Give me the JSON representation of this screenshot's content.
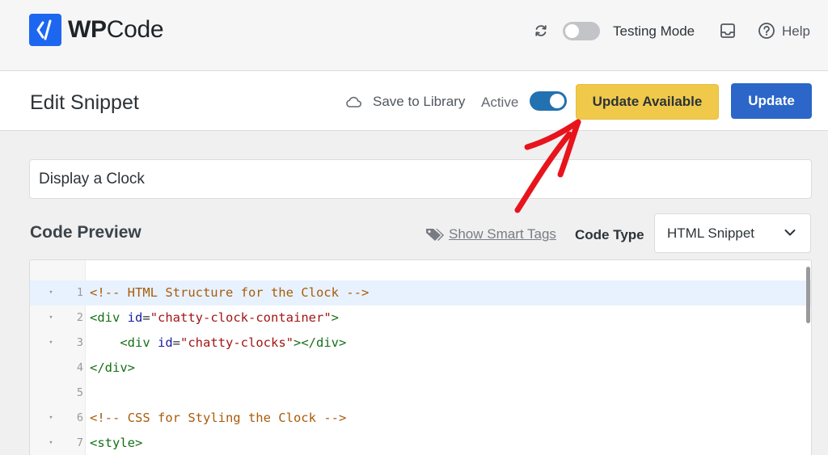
{
  "header": {
    "logo_bold": "WP",
    "logo_light": "Code",
    "testing_mode_label": "Testing Mode",
    "help_label": "Help"
  },
  "editbar": {
    "title": "Edit Snippet",
    "save_to_library": "Save to Library",
    "active_label": "Active",
    "update_available_label": "Update Available",
    "update_label": "Update"
  },
  "snippet": {
    "title_value": "Display a Clock"
  },
  "code_preview": {
    "label": "Code Preview",
    "smart_tags_link": "Show Smart Tags",
    "code_type_label": "Code Type",
    "code_type_value": "HTML Snippet"
  },
  "editor": {
    "lines": [
      {
        "num": "1",
        "fold": "▾"
      },
      {
        "num": "2",
        "fold": "▾"
      },
      {
        "num": "3",
        "fold": "▾"
      },
      {
        "num": "4",
        "fold": ""
      },
      {
        "num": "5",
        "fold": ""
      },
      {
        "num": "6",
        "fold": "▾"
      },
      {
        "num": "7",
        "fold": "▾"
      }
    ],
    "code": {
      "l1_comment": "<!-- HTML Structure for the Clock -->",
      "l2_open": "<div ",
      "l2_attr": "id",
      "l2_eq": "=",
      "l2_val": "\"chatty-clock-container\"",
      "l2_close": ">",
      "l3_indent": "    ",
      "l3_open": "<div ",
      "l3_attr": "id",
      "l3_eq": "=",
      "l3_val": "\"chatty-clocks\"",
      "l3_close": "></div>",
      "l4_close": "</div>",
      "l6_comment": "<!-- CSS for Styling the Clock -->",
      "l7_open": "<style>"
    }
  },
  "colors": {
    "brand_blue": "#1d67f0",
    "update_button": "#2b66c8",
    "update_available": "#f0c94a",
    "toggle_active": "#2271b1",
    "annotation_arrow": "#e8141c"
  }
}
